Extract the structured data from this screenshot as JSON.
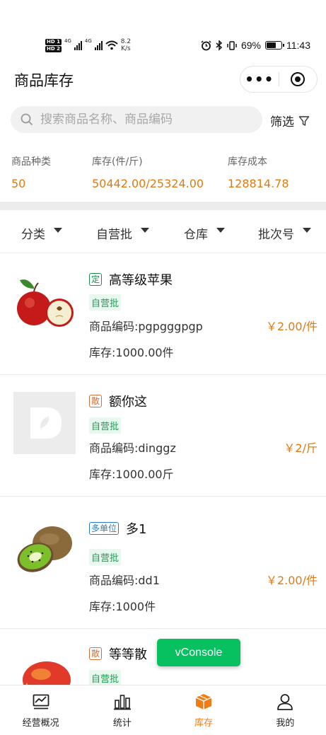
{
  "status_bar": {
    "hd1": "HD 1",
    "hd2": "HD 2",
    "net1": "4G",
    "net2": "4G",
    "speed_value": "8.2",
    "speed_unit": "K/s",
    "battery": "69%",
    "battery_level": 0.69,
    "time": "11:43"
  },
  "header": {
    "title": "商品库存"
  },
  "search": {
    "placeholder": "搜索商品名称、商品编码",
    "filter_label": "筛选"
  },
  "stats": [
    {
      "label": "商品种类",
      "value": "50"
    },
    {
      "label": "库存(件/斤)",
      "value": "50442.00/25324.00"
    },
    {
      "label": "库存成本",
      "value": "128814.78"
    }
  ],
  "filters": [
    {
      "label": "分类"
    },
    {
      "label": "自营批"
    },
    {
      "label": "仓库"
    },
    {
      "label": "批次号"
    }
  ],
  "products": [
    {
      "tag": "定",
      "name": "高等级苹果",
      "batch": "自营批",
      "code": "商品编码:pgpgggpgp",
      "price": "￥2.00/件",
      "stock": "库存:1000.00件",
      "image": "apple"
    },
    {
      "tag": "散",
      "name": "额你这",
      "batch": "自营批",
      "code": "商品编码:dinggz",
      "price": "￥2/斤",
      "stock": "库存:1000.00斤",
      "image": "placeholder-logo"
    },
    {
      "tag": "多单位",
      "name": "多1",
      "batch": "自营批",
      "code": "商品编码:dd1",
      "price": "￥2.00/件",
      "stock": "库存:1000件",
      "image": "kiwi"
    },
    {
      "tag": "散",
      "name": "等等散",
      "batch": "自营批",
      "image": "mango"
    }
  ],
  "vconsole": {
    "label": "vConsole"
  },
  "tabbar": [
    {
      "label": "经营概况",
      "icon": "chart-icon"
    },
    {
      "label": "统计",
      "icon": "bar-chart-icon"
    },
    {
      "label": "库存",
      "icon": "box-icon",
      "active": true
    },
    {
      "label": "我的",
      "icon": "user-icon"
    }
  ],
  "colors": {
    "accent": "#f07c17",
    "price": "#e07a12",
    "green": "#07c160",
    "batch_bg": "#e9f8ef"
  }
}
